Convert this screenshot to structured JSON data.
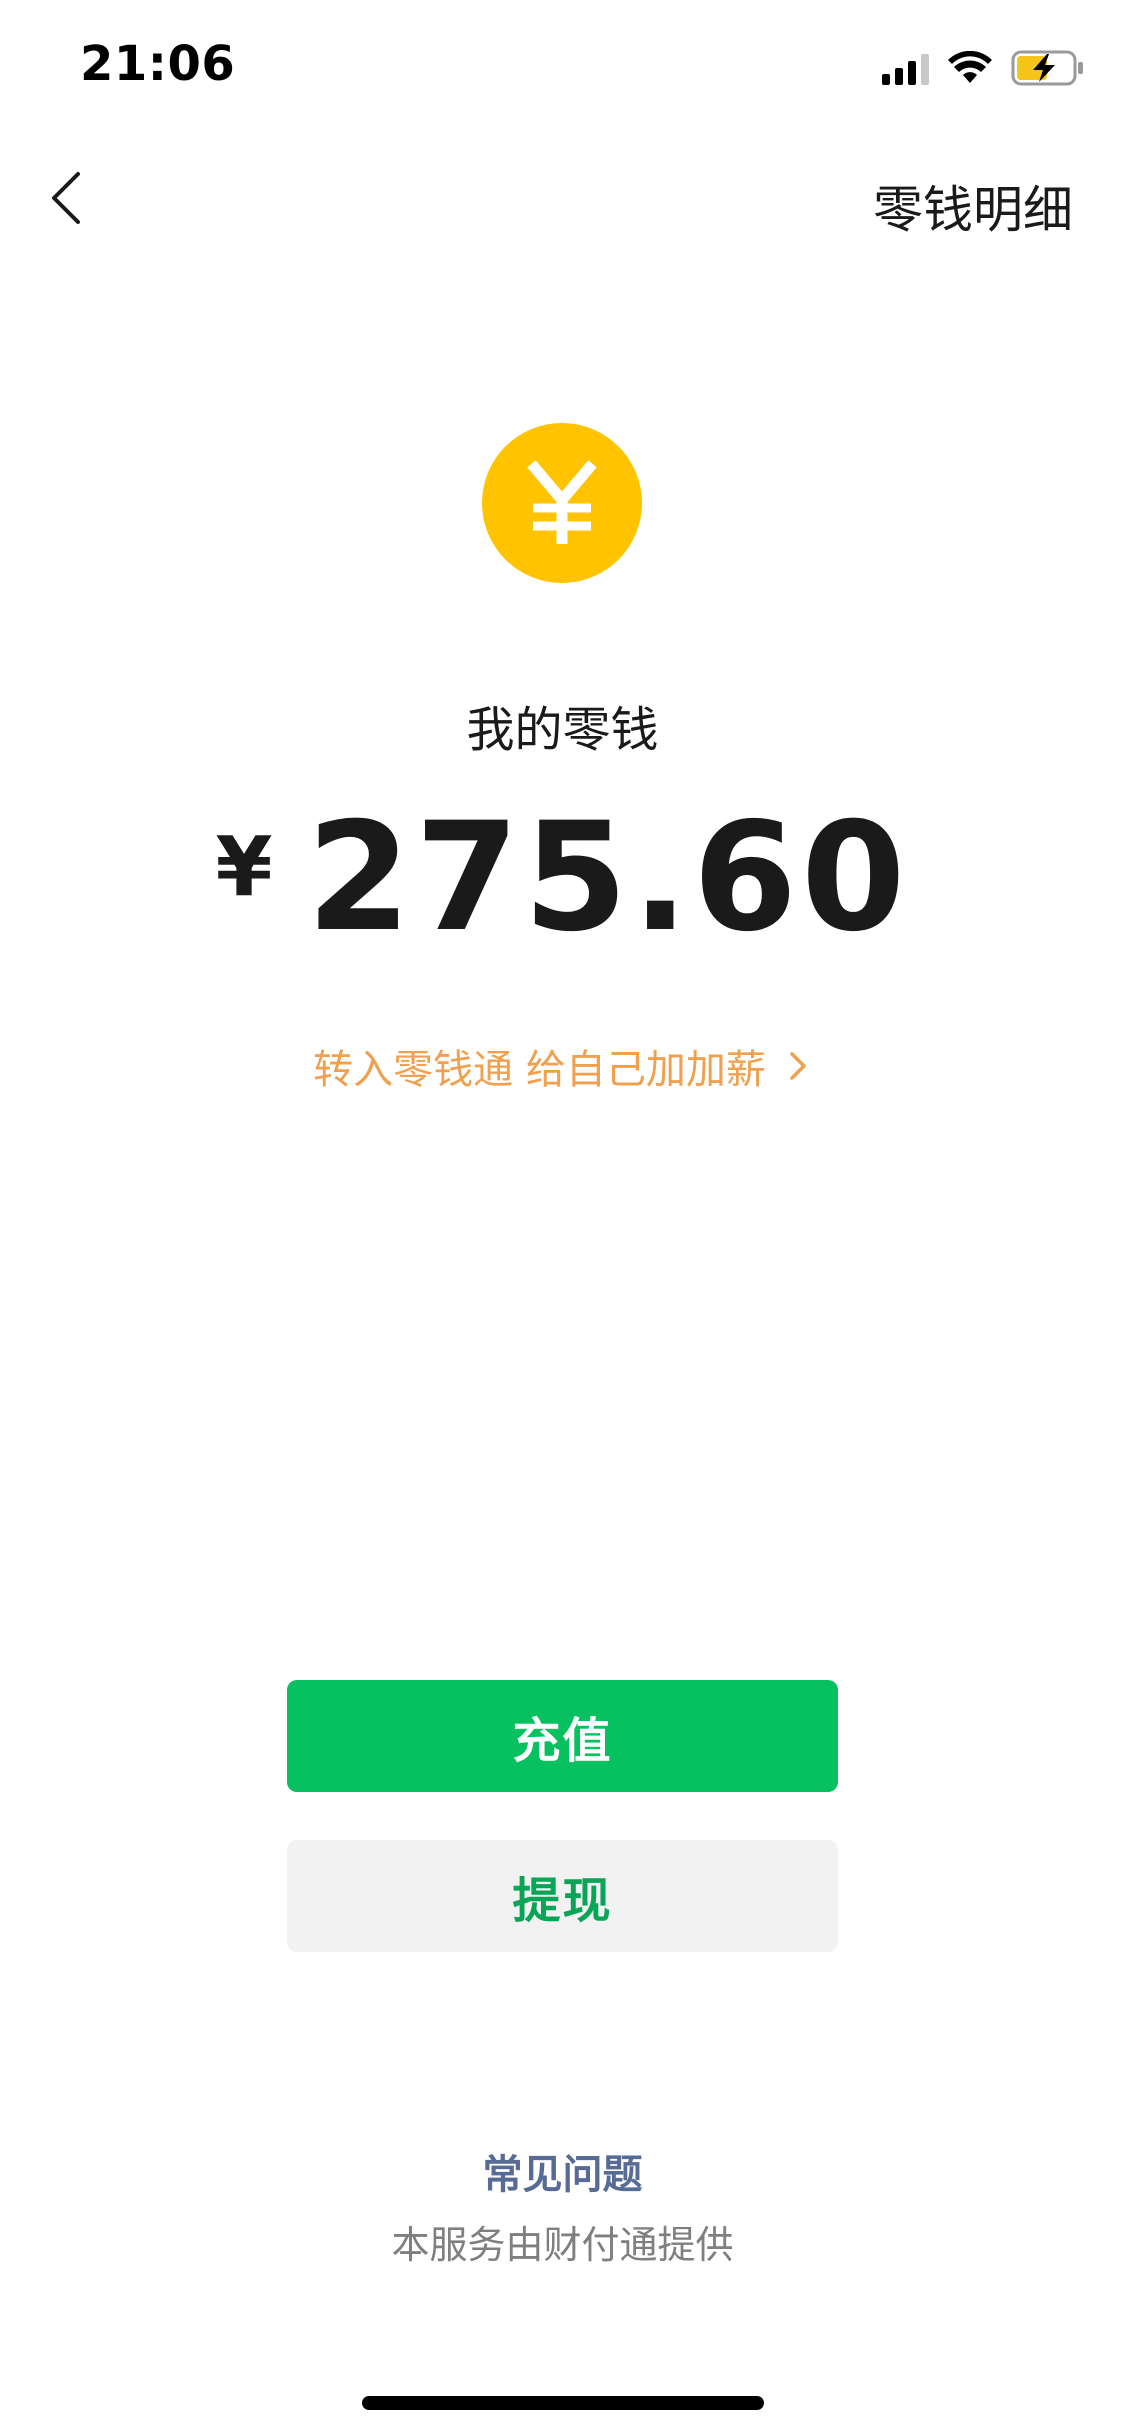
{
  "status_bar": {
    "time": "21:06"
  },
  "nav": {
    "right_action": "零钱明细"
  },
  "wallet": {
    "icon_symbol": "¥",
    "label": "我的零钱",
    "currency_symbol": "¥",
    "amount": "275.60"
  },
  "promo": {
    "text": "转入零钱通 给自己加加薪"
  },
  "actions": {
    "recharge_label": "充值",
    "withdraw_label": "提现"
  },
  "footer": {
    "faq_label": "常见问题",
    "provider_note": "本服务由财付通提供"
  },
  "colors": {
    "primary_green": "#07c160",
    "coin_yellow": "#ffc300",
    "promo_orange": "#f0a150",
    "link_blue": "#576b95"
  }
}
